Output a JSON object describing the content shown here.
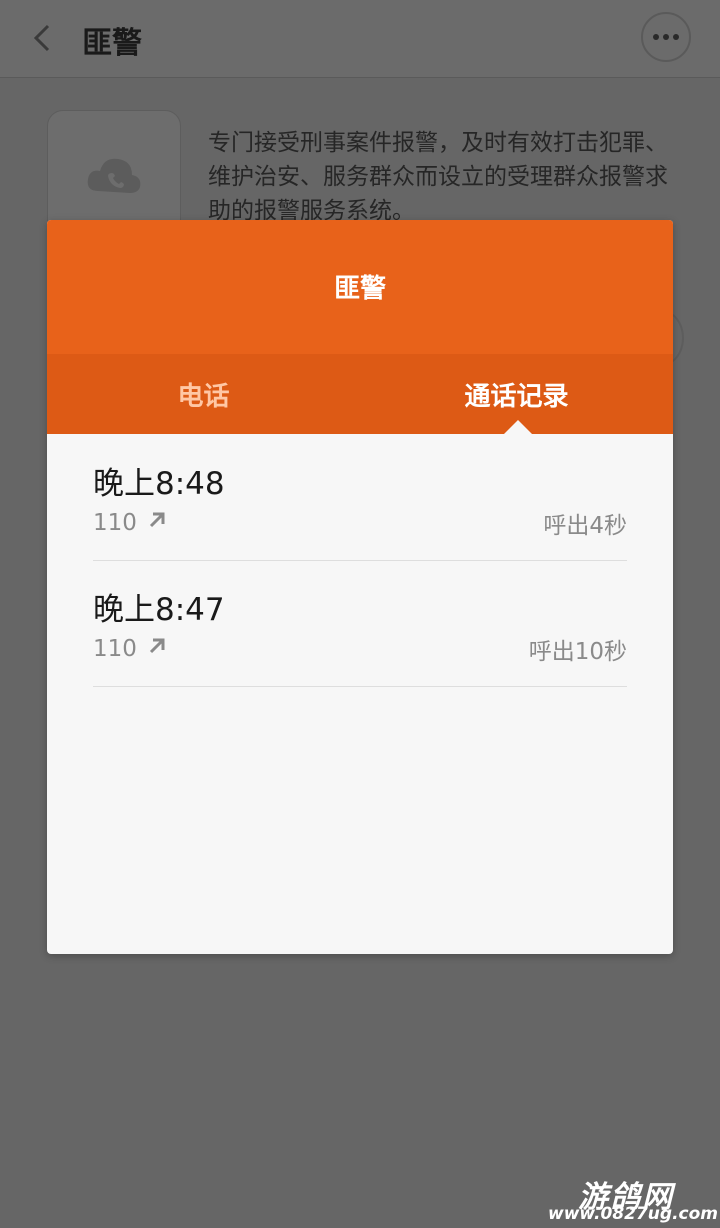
{
  "header": {
    "title": "匪警",
    "back_icon": "chevron-left-icon",
    "more_icon": "more-dots-icon"
  },
  "contact": {
    "avatar_icon": "cloud-phone-icon",
    "description": "专门接受刑事案件报警，及时有效打击犯罪、维护治安、服务群众而设立的受理群众报警求助的报警服务系统。"
  },
  "dialog": {
    "title": "匪警",
    "tabs": [
      {
        "label": "电话",
        "active": false
      },
      {
        "label": "通话记录",
        "active": true
      }
    ],
    "call_log": [
      {
        "time": "晚上8:48",
        "number": "110",
        "direction_icon": "outgoing-arrow-icon",
        "duration": "呼出4秒"
      },
      {
        "time": "晚上8:47",
        "number": "110",
        "direction_icon": "outgoing-arrow-icon",
        "duration": "呼出10秒"
      }
    ]
  },
  "watermark": {
    "brand": "游鸽网",
    "url": "www.0827ug.com"
  },
  "colors": {
    "accent": "#e8621a",
    "tab_bar": "#dd5a15",
    "overlay": "#666666"
  }
}
